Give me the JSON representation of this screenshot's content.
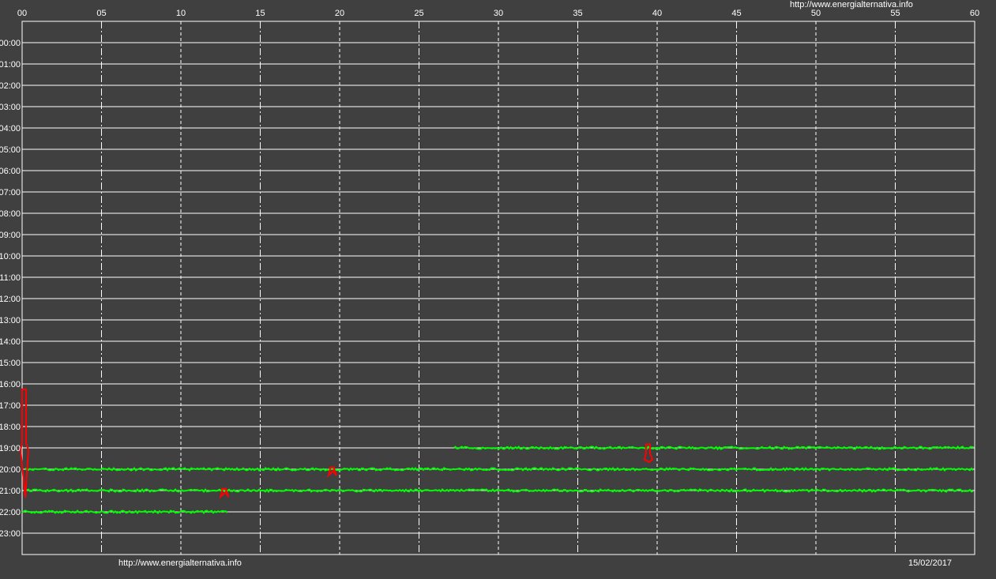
{
  "url_top": "http://www.energialternativa.info",
  "url_bottom": "http://www.energialternativa.info",
  "date": "15/02/2017",
  "colors": {
    "background": "#404040",
    "grid": "#ffffff",
    "trace": "#00ff00",
    "trace_alt": "#ff0000",
    "text": "#ffffff"
  },
  "chart_data": {
    "type": "line",
    "x_ticks": [
      "00",
      "05",
      "10",
      "15",
      "20",
      "25",
      "30",
      "35",
      "40",
      "45",
      "50",
      "55",
      "60"
    ],
    "y_ticks": [
      "00:00",
      "01:00",
      "02:00",
      "03:00",
      "04:00",
      "05:00",
      "06:00",
      "07:00",
      "08:00",
      "09:00",
      "10:00",
      "11:00",
      "12:00",
      "13:00",
      "14:00",
      "15:00",
      "16:00",
      "17:00",
      "18:00",
      "19:00",
      "20:00",
      "21:00",
      "22:00",
      "23:00"
    ],
    "xlim": [
      0,
      60
    ],
    "grid": true,
    "series": [
      {
        "color": "#00ff00",
        "segments": [
          {
            "row": "19:00",
            "x_start": 27.2,
            "x_end": 60
          },
          {
            "row": "20:00",
            "x_start": 0.2,
            "x_end": 60
          },
          {
            "row": "21:00",
            "x_start": 0.2,
            "x_end": 60
          },
          {
            "row": "22:00",
            "x_start": 0,
            "x_end": 13
          }
        ]
      },
      {
        "color": "#ff0000",
        "bursts": [
          {
            "x": 0.1,
            "from": "16:15",
            "to": "21:20"
          },
          {
            "x": 39.4,
            "from": "18:50",
            "to": "19:40"
          },
          {
            "x": 12.7,
            "from": "20:55",
            "to": "21:05"
          },
          {
            "x": 19.5,
            "from": "19:55",
            "to": "20:05"
          }
        ]
      }
    ]
  }
}
